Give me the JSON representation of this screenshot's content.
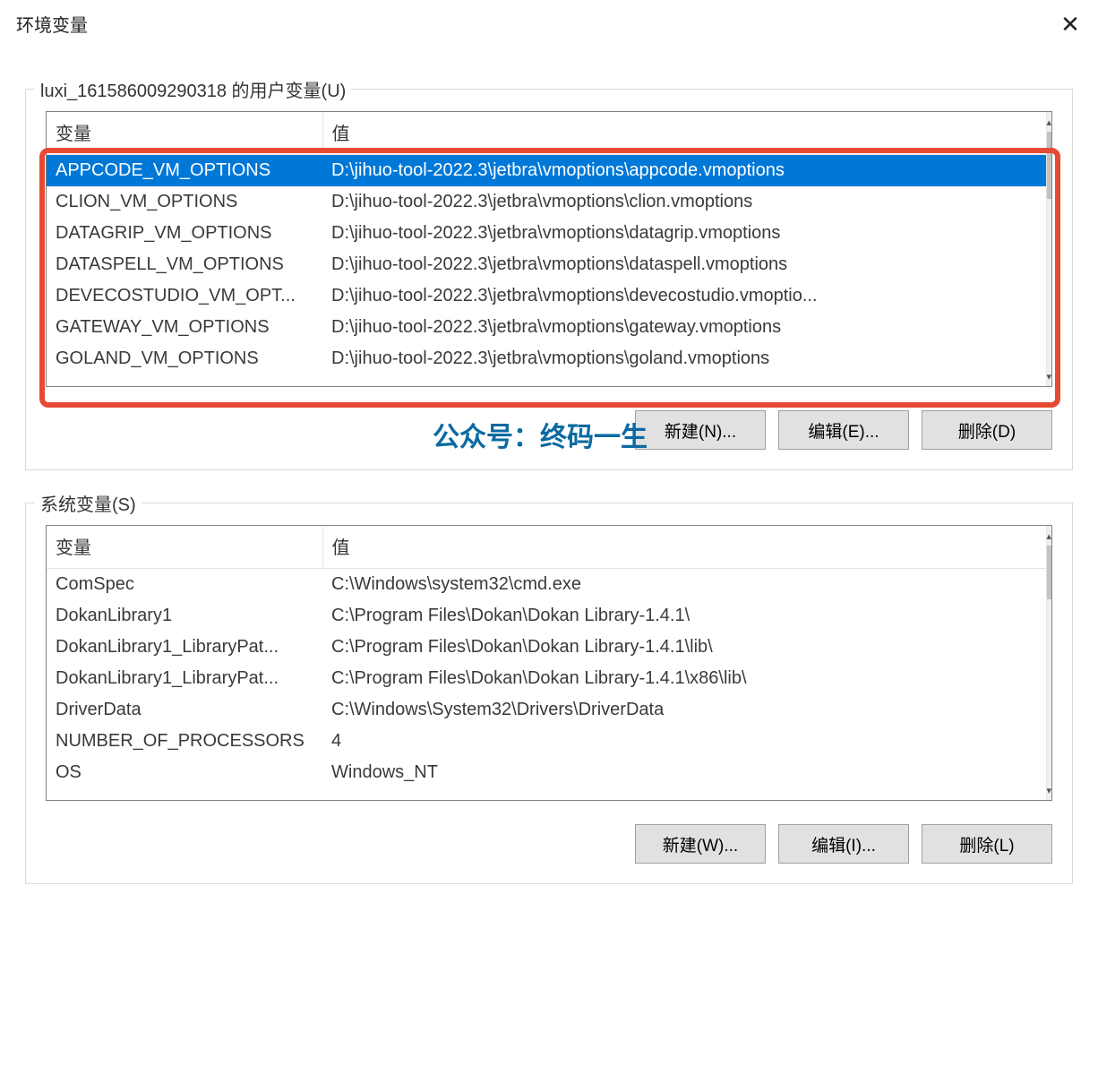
{
  "window": {
    "title": "环境变量",
    "close_glyph": "✕"
  },
  "user_section": {
    "legend": "luxi_161586009290318 的用户变量(U)",
    "header_var": "变量",
    "header_val": "值",
    "rows": [
      {
        "var": "APPCODE_VM_OPTIONS",
        "val": "D:\\jihuo-tool-2022.3\\jetbra\\vmoptions\\appcode.vmoptions",
        "selected": true
      },
      {
        "var": "CLION_VM_OPTIONS",
        "val": "D:\\jihuo-tool-2022.3\\jetbra\\vmoptions\\clion.vmoptions"
      },
      {
        "var": "DATAGRIP_VM_OPTIONS",
        "val": "D:\\jihuo-tool-2022.3\\jetbra\\vmoptions\\datagrip.vmoptions"
      },
      {
        "var": "DATASPELL_VM_OPTIONS",
        "val": "D:\\jihuo-tool-2022.3\\jetbra\\vmoptions\\dataspell.vmoptions"
      },
      {
        "var": "DEVECOSTUDIO_VM_OPT...",
        "val": "D:\\jihuo-tool-2022.3\\jetbra\\vmoptions\\devecostudio.vmoptio..."
      },
      {
        "var": "GATEWAY_VM_OPTIONS",
        "val": "D:\\jihuo-tool-2022.3\\jetbra\\vmoptions\\gateway.vmoptions"
      },
      {
        "var": "GOLAND_VM_OPTIONS",
        "val": "D:\\jihuo-tool-2022.3\\jetbra\\vmoptions\\goland.vmoptions"
      }
    ],
    "buttons": {
      "new": "新建(N)...",
      "edit": "编辑(E)...",
      "delete": "删除(D)"
    },
    "watermark": "公众号：终码一生"
  },
  "system_section": {
    "legend": "系统变量(S)",
    "header_var": "变量",
    "header_val": "值",
    "rows": [
      {
        "var": "ComSpec",
        "val": "C:\\Windows\\system32\\cmd.exe"
      },
      {
        "var": "DokanLibrary1",
        "val": "C:\\Program Files\\Dokan\\Dokan Library-1.4.1\\"
      },
      {
        "var": "DokanLibrary1_LibraryPat...",
        "val": "C:\\Program Files\\Dokan\\Dokan Library-1.4.1\\lib\\"
      },
      {
        "var": "DokanLibrary1_LibraryPat...",
        "val": "C:\\Program Files\\Dokan\\Dokan Library-1.4.1\\x86\\lib\\"
      },
      {
        "var": "DriverData",
        "val": "C:\\Windows\\System32\\Drivers\\DriverData"
      },
      {
        "var": "NUMBER_OF_PROCESSORS",
        "val": "4"
      },
      {
        "var": "OS",
        "val": "Windows_NT"
      }
    ],
    "buttons": {
      "new": "新建(W)...",
      "edit": "编辑(I)...",
      "delete": "删除(L)"
    }
  }
}
